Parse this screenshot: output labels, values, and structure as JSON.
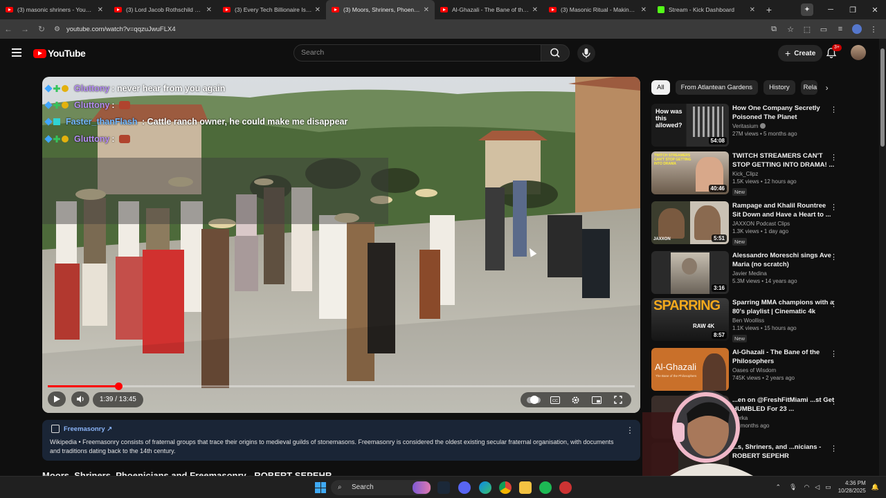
{
  "browser": {
    "tabs": [
      {
        "title": "(3) masonic shriners - YouTube",
        "icon": "youtube-favicon"
      },
      {
        "title": "(3) Lord Jacob Rothschild Con",
        "icon": "youtube-favicon"
      },
      {
        "title": "(3) Every Tech Billionaire Is Ha",
        "icon": "youtube-favicon"
      },
      {
        "title": "(3) Moors, Shriners, Phoenicia",
        "icon": "youtube-favicon",
        "active": true
      },
      {
        "title": "Al-Ghazali - The Bane of the Pl",
        "icon": "youtube-favicon"
      },
      {
        "title": "(3) Masonic Ritual - Making Of",
        "icon": "youtube-favicon"
      },
      {
        "title": "Stream - Kick Dashboard",
        "icon": "kick-favicon"
      }
    ],
    "url": "youtube.com/watch?v=qqzuJwuFLX4"
  },
  "header": {
    "logo_text": "YouTube",
    "search_placeholder": "Search",
    "create_label": "Create",
    "notification_count": "3+"
  },
  "player": {
    "current_time": "1:39",
    "duration": "13:45",
    "time_display": "1:39 / 13:45",
    "progress_fraction": 0.12
  },
  "chat": [
    {
      "user": "Gluttony",
      "sep": ":",
      "message": "never hear from you again",
      "emote": false,
      "color": "purple"
    },
    {
      "user": "Gluttony",
      "sep": ":",
      "message": "",
      "emote": true,
      "color": "purple"
    },
    {
      "user": "Faster_thanFlash",
      "sep": ":",
      "message": "Cattle ranch owner, he could make me disappear",
      "emote": false,
      "color": "blue"
    },
    {
      "user": "Gluttony",
      "sep": ":",
      "message": "",
      "emote": true,
      "color": "purple"
    }
  ],
  "info_panel": {
    "source_label": "Freemasonry ↗",
    "text": "Wikipedia • Freemasonry consists of fraternal groups that trace their origins to medieval guilds of stonemasons. Freemasonry is considered the oldest existing secular fraternal organisation, with documents and traditions dating back to the 14th century."
  },
  "video_title": "Moors, Shriners, Phoenicians and Freemasonry - ROBERT SEPEHR",
  "chips": [
    "All",
    "From Atlantean Gardens",
    "History",
    "Rela"
  ],
  "recommendations": [
    {
      "title": "How One Company Secretly Poisoned The Planet",
      "channel": "Veritasium",
      "verified": true,
      "views": "27M views • 5 months ago",
      "duration": "54:08",
      "new": false
    },
    {
      "title": "TWITCH STREAMERS CAN'T STOP GETTING INTO DRAMA! ...",
      "channel": "Kick_Clipz",
      "verified": false,
      "views": "1.5K views • 12 hours ago",
      "duration": "40:46",
      "new": true
    },
    {
      "title": "Rampage and Khalil Rountree Sit Down and Have a Heart to ...",
      "channel": "JAXXON Podcast Clips",
      "verified": false,
      "views": "1.3K views • 1 day ago",
      "duration": "5:51",
      "new": true
    },
    {
      "title": "Alessandro Moreschi sings Ave Maria (no scratch)",
      "channel": "Javier Medina",
      "verified": false,
      "views": "5.3M views • 14 years ago",
      "duration": "3:16",
      "new": false
    },
    {
      "title": "Sparring MMA champions with a 80's playlist | Cinematic 4k",
      "channel": "Ben Woolliss",
      "verified": false,
      "views": "1.1K views • 15 hours ago",
      "duration": "8:57",
      "new": true
    },
    {
      "title": "Al-Ghazali - The Bane of the Philosophers",
      "channel": "Oases of Wisdom",
      "verified": false,
      "views": "745K views • 2 years ago",
      "duration": "",
      "new": false
    },
    {
      "title": "...en on @FreshFitMiami ...st Get HUMBLED For 23 ...",
      "channel": "...erka",
      "verified": false,
      "views": "• 4 months ago",
      "duration": "",
      "new": false
    },
    {
      "title": "...s, Shriners, and ...nicians - ROBERT SEPEHR",
      "channel": "",
      "verified": false,
      "views": "",
      "duration": "",
      "new": false
    }
  ],
  "thumb_text": {
    "t1": "How was this allowed?",
    "t2": "TWITCH STREAMERS CAN'T STOP GETTING INTO DRAMA",
    "t3": "JAXXON",
    "t5": "SPARRING",
    "t5b": "RAW 4K",
    "t6": "Al-Ghazali",
    "t6b": "The Bane of the Philosophers"
  },
  "taskbar": {
    "search_label": "Search",
    "time": "4:36 PM",
    "date": "10/28/2025"
  },
  "colors": {
    "accent": "#ff0000",
    "background": "#0f0f0f",
    "info_panel": "#1a2536",
    "link": "#8ab4f8"
  }
}
